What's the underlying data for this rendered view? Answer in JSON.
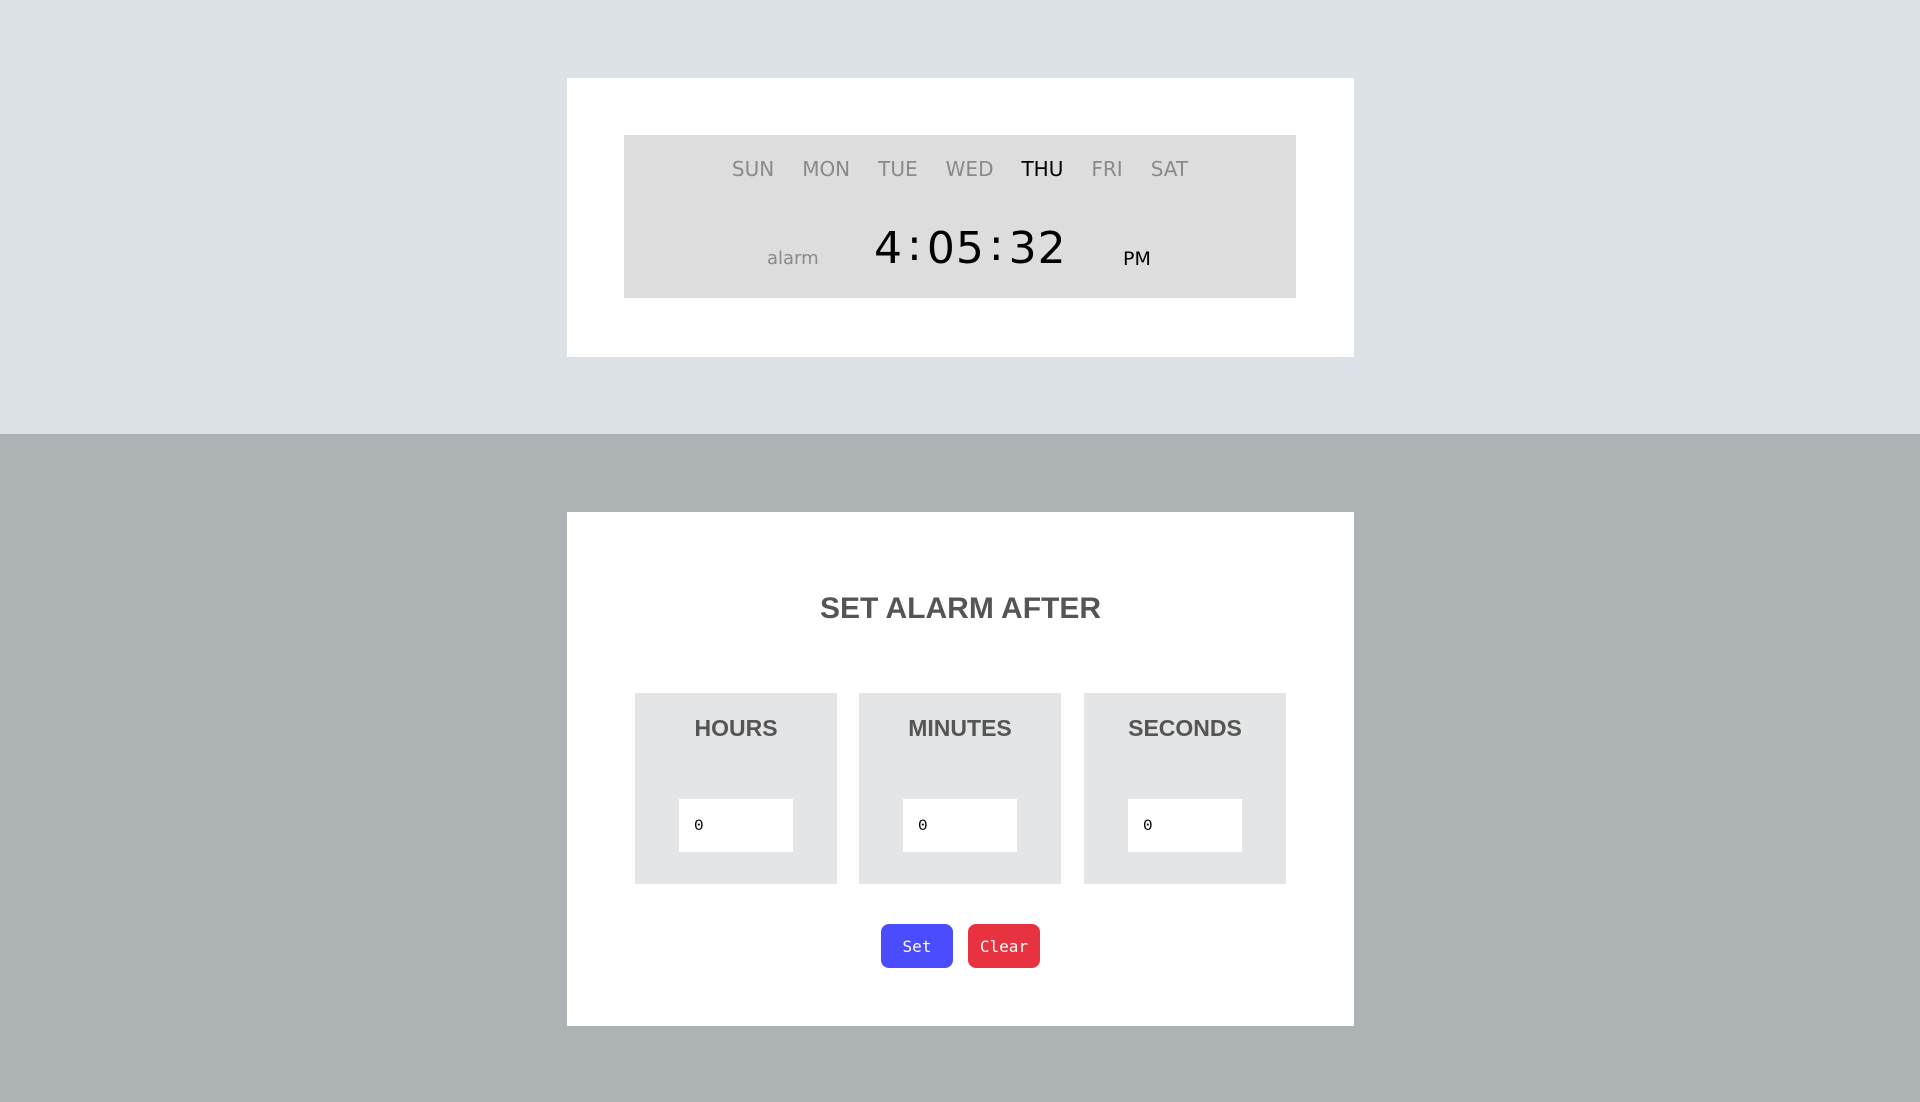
{
  "clock": {
    "days": [
      "SUN",
      "MON",
      "TUE",
      "WED",
      "THU",
      "FRI",
      "SAT"
    ],
    "active_day": "THU",
    "alarm_label": "alarm",
    "hours": "4",
    "minutes": "05",
    "seconds": "32",
    "separator": ":",
    "ampm": "PM"
  },
  "alarm": {
    "title": "SET ALARM AFTER",
    "units": [
      {
        "label": "HOURS",
        "value": "0"
      },
      {
        "label": "MINUTES",
        "value": "0"
      },
      {
        "label": "SECONDS",
        "value": "0"
      }
    ],
    "set_label": "Set",
    "clear_label": "Clear"
  },
  "colors": {
    "top_background": "#dce2e5",
    "bottom_background": "#adb2b5",
    "display_background": "#dddddd",
    "unit_box_background": "#e3e5e6",
    "set_button": "#4b4cff",
    "clear_button": "#e8323f",
    "inactive_day": "#8a8a8a",
    "active_day": "#000000"
  }
}
